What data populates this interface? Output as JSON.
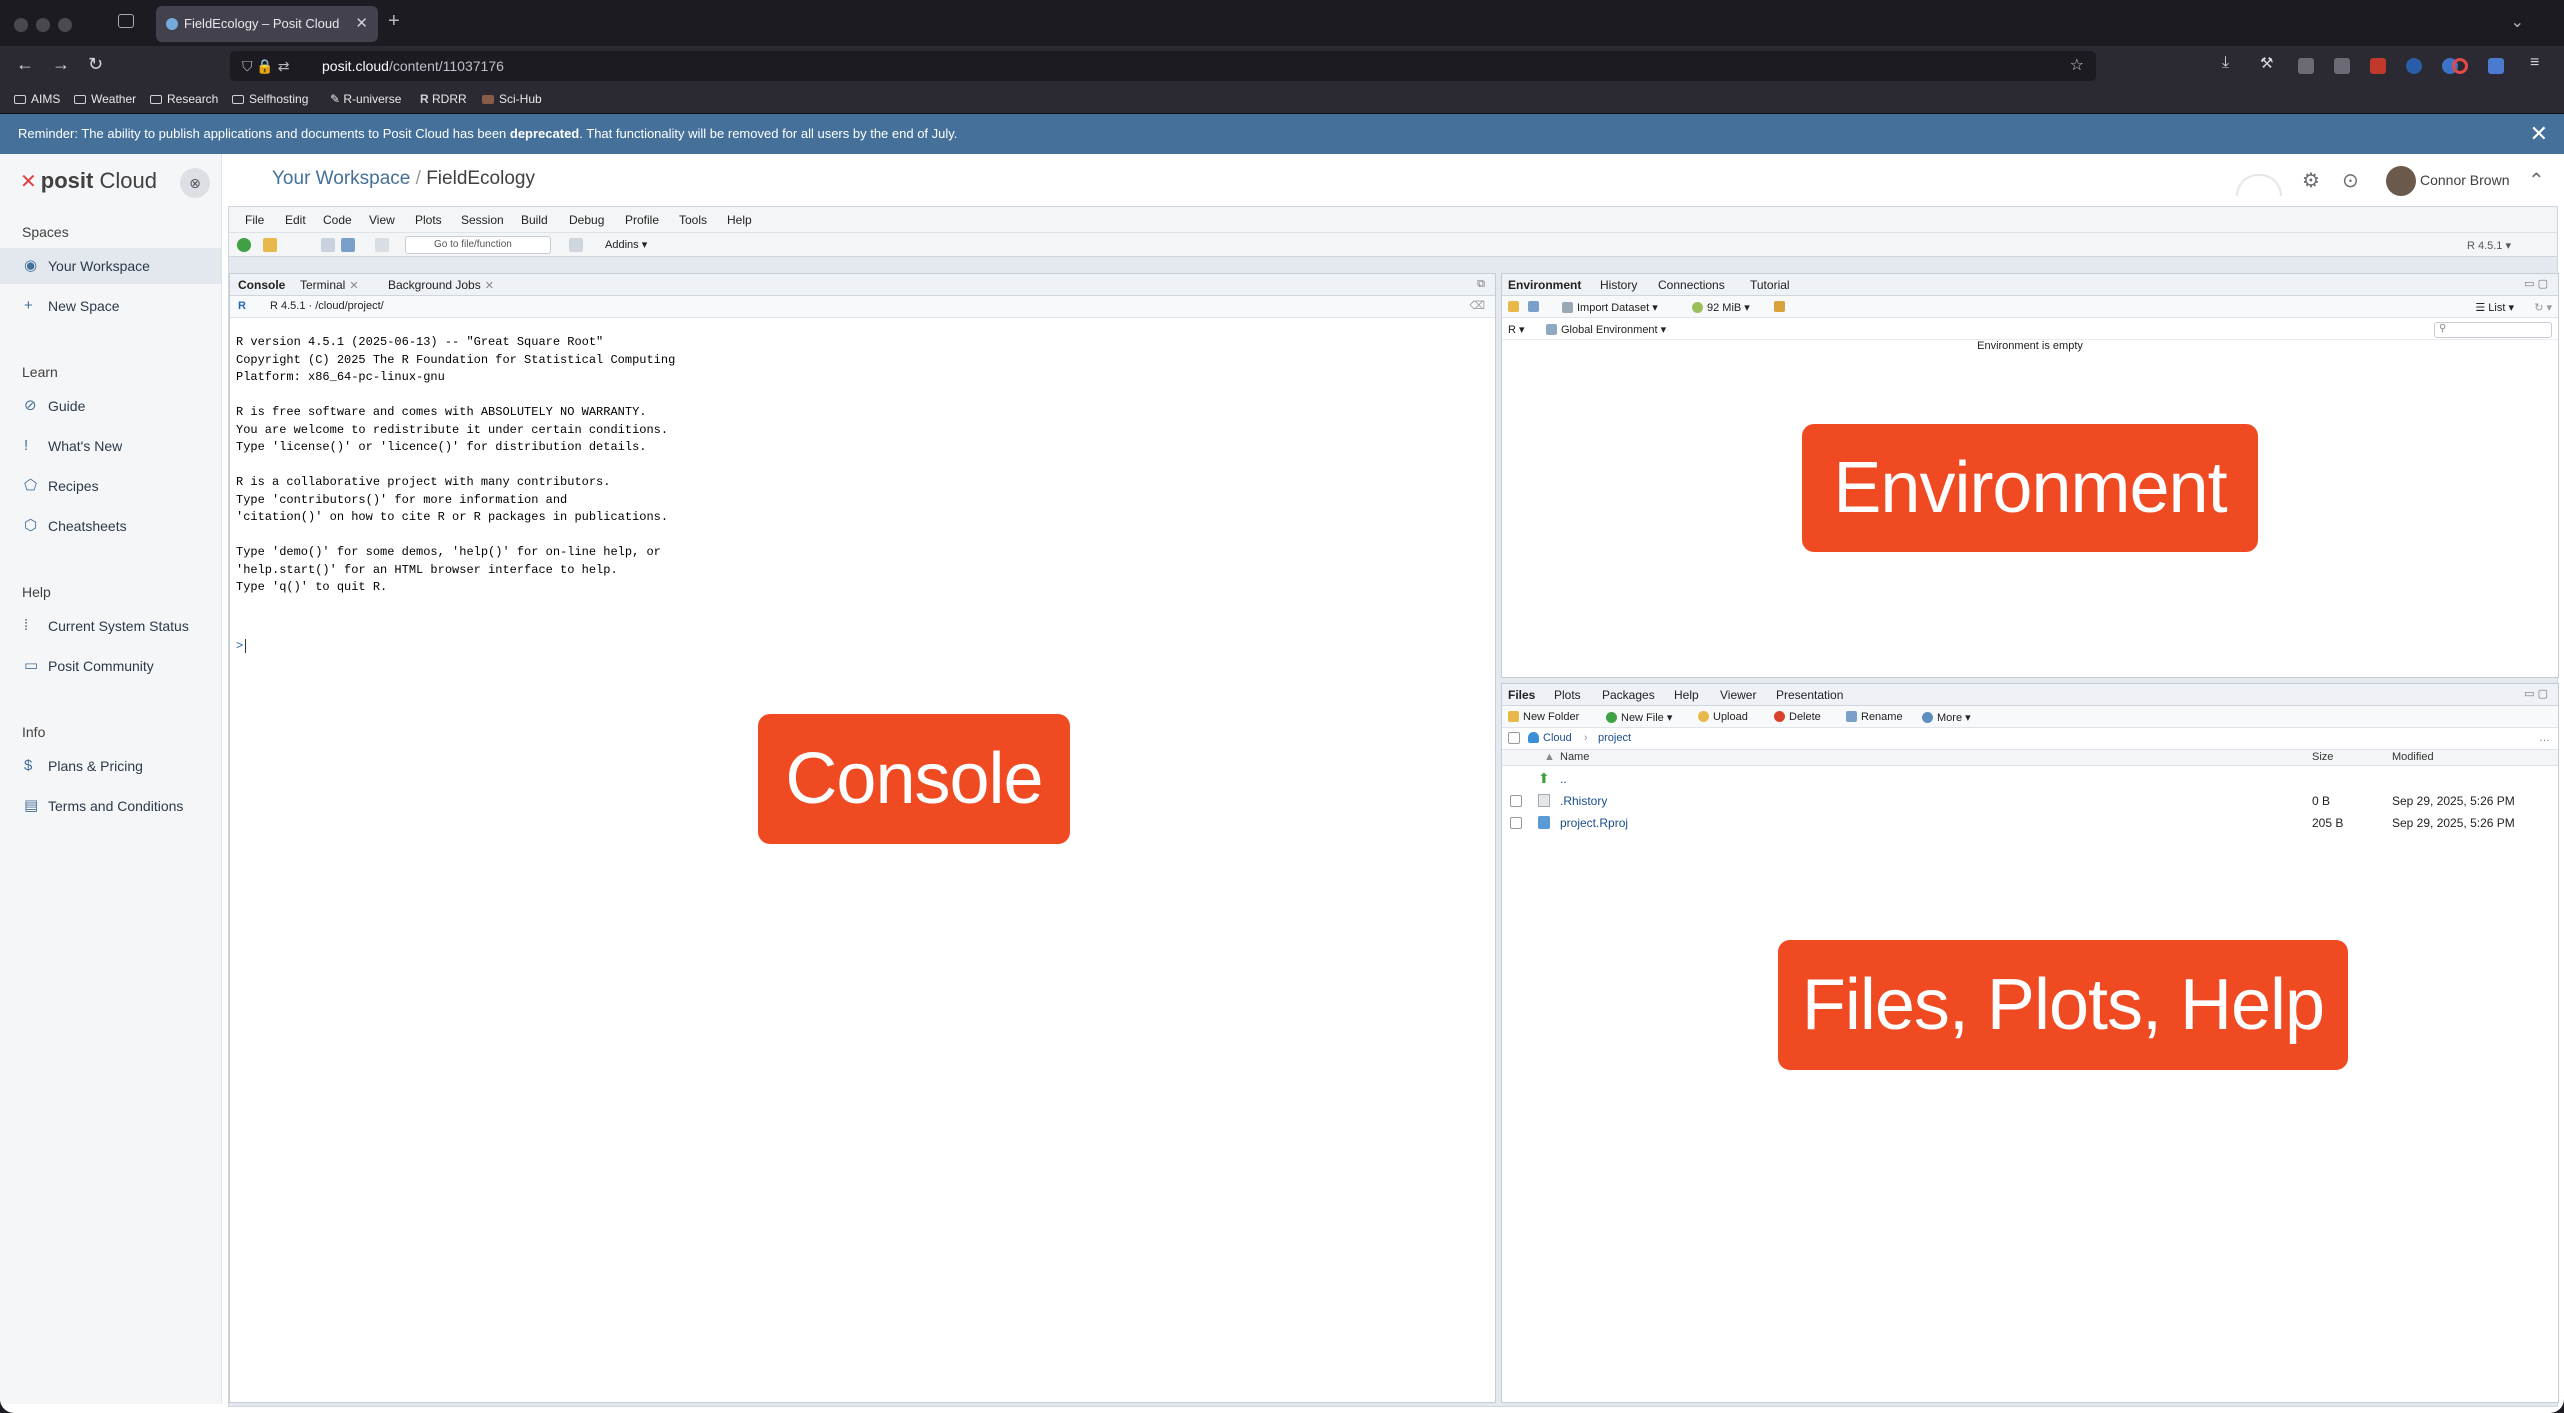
{
  "browser": {
    "tab_title": "FieldEcology – Posit Cloud",
    "new_tab": "+",
    "url_host": "posit.cloud",
    "url_path": "/content/11037176",
    "bookmarks": [
      "AIMS",
      "Weather",
      "Research",
      "Selfhosting",
      "R-universe",
      "RDRR",
      "Sci-Hub"
    ]
  },
  "banner": {
    "text_before": "Reminder: The ability to publish applications and documents to Posit Cloud has been ",
    "bold": "deprecated",
    "text_after": ". That functionality will be removed for all users by the end of July.",
    "close": "✕"
  },
  "sidebar": {
    "logo_word": "posit",
    "logo_product": "Cloud",
    "close_label": "⊗",
    "spaces_heading": "Spaces",
    "your_workspace": "Your Workspace",
    "new_space": "New Space",
    "learn_heading": "Learn",
    "guide": "Guide",
    "whats_new": "What's New",
    "recipes": "Recipes",
    "cheatsheets": "Cheatsheets",
    "help_heading": "Help",
    "system_status": "Current System Status",
    "community": "Posit Community",
    "info_heading": "Info",
    "plans": "Plans & Pricing",
    "terms": "Terms and Conditions"
  },
  "header": {
    "workspace": "Your Workspace",
    "separator": "/",
    "project": "FieldEcology",
    "user": "Connor Brown"
  },
  "rstudio": {
    "menu": [
      "File",
      "Edit",
      "Code",
      "View",
      "Plots",
      "Session",
      "Build",
      "Debug",
      "Profile",
      "Tools",
      "Help"
    ],
    "goto_placeholder": "Go to file/function",
    "addins": "Addins",
    "r_version_label": "R 4.5.1",
    "console_tabs": [
      "Console",
      "Terminal",
      "Background Jobs"
    ],
    "console_path": "R 4.5.1 · /cloud/project/",
    "console_lines": [
      "R version 4.5.1 (2025-06-13) -- \"Great Square Root\"",
      "Copyright (C) 2025 The R Foundation for Statistical Computing",
      "Platform: x86_64-pc-linux-gnu",
      "",
      "R is free software and comes with ABSOLUTELY NO WARRANTY.",
      "You are welcome to redistribute it under certain conditions.",
      "Type 'license()' or 'licence()' for distribution details.",
      "",
      "R is a collaborative project with many contributors.",
      "Type 'contributors()' for more information and",
      "'citation()' on how to cite R or R packages in publications.",
      "",
      "Type 'demo()' for some demos, 'help()' for on-line help, or",
      "'help.start()' for an HTML browser interface to help.",
      "Type 'q()' to quit R."
    ],
    "prompt": ">",
    "env_tabs": [
      "Environment",
      "History",
      "Connections",
      "Tutorial"
    ],
    "import_dataset": "Import Dataset",
    "memory": "92 MiB",
    "list_view": "List",
    "r_lang": "R",
    "global_env": "Global Environment",
    "env_empty": "Environment is empty",
    "files_tabs": [
      "Files",
      "Plots",
      "Packages",
      "Help",
      "Viewer",
      "Presentation"
    ],
    "new_folder": "New Folder",
    "new_file": "New File",
    "upload": "Upload",
    "delete": "Delete",
    "rename": "Rename",
    "more": "More",
    "path_cloud": "Cloud",
    "path_project": "project",
    "col_name": "Name",
    "col_size": "Size",
    "col_modified": "Modified",
    "parent_dir": "..",
    "files": [
      {
        "name": ".Rhistory",
        "size": "0 B",
        "modified": "Sep 29, 2025, 5:26 PM"
      },
      {
        "name": "project.Rproj",
        "size": "205 B",
        "modified": "Sep 29, 2025, 5:26 PM"
      }
    ]
  },
  "overlays": {
    "console": "Console",
    "environment": "Environment",
    "files": "Files, Plots, Help"
  },
  "colors": {
    "overlay": "#f04a23",
    "banner": "#447099",
    "accent": "#447099"
  }
}
